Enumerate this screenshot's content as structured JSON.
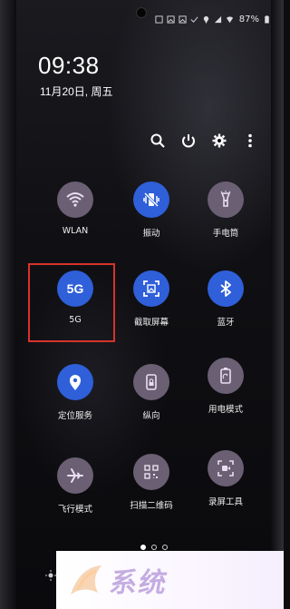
{
  "status_bar": {
    "battery": "87%",
    "icons": [
      "photo-icon",
      "gallery-icon",
      "gallery-icon",
      "check-icon",
      "location-icon",
      "signal-icon",
      "wifi-icon",
      "battery-icon"
    ]
  },
  "clock": {
    "time": "09:38",
    "date": "11月20日, 周五"
  },
  "toolbar": {
    "icons": [
      "search-icon",
      "power-icon",
      "gear-icon",
      "more-icon"
    ]
  },
  "tiles": [
    {
      "label": "WLAN",
      "icon": "wifi-icon",
      "state": "off"
    },
    {
      "label": "振动",
      "icon": "vibrate-icon",
      "state": "on"
    },
    {
      "label": "手电筒",
      "icon": "flashlight-icon",
      "state": "off"
    },
    {
      "label": "5G",
      "icon_text": "5G",
      "state": "on"
    },
    {
      "label": "截取屏幕",
      "icon": "screenshot-icon",
      "state": "on"
    },
    {
      "label": "蓝牙",
      "icon": "bluetooth-icon",
      "state": "on"
    },
    {
      "label": "定位服务",
      "icon": "location-icon",
      "state": "on"
    },
    {
      "label": "纵向",
      "icon": "rotation-lock-icon",
      "state": "off"
    },
    {
      "label": "用电模式",
      "icon": "power-mode-icon",
      "state": "off"
    },
    {
      "label": "飞行模式",
      "icon": "airplane-icon",
      "state": "off"
    },
    {
      "label": "扫描二维码",
      "icon": "qr-icon",
      "state": "off"
    },
    {
      "label": "录屏工具",
      "icon": "screen-record-icon",
      "state": "off"
    }
  ],
  "page_indicator": {
    "pages": 3,
    "current": 1
  },
  "colors": {
    "active": "#2f5fd9",
    "inactive": "#6b5f73",
    "highlight": "#d8322b"
  }
}
